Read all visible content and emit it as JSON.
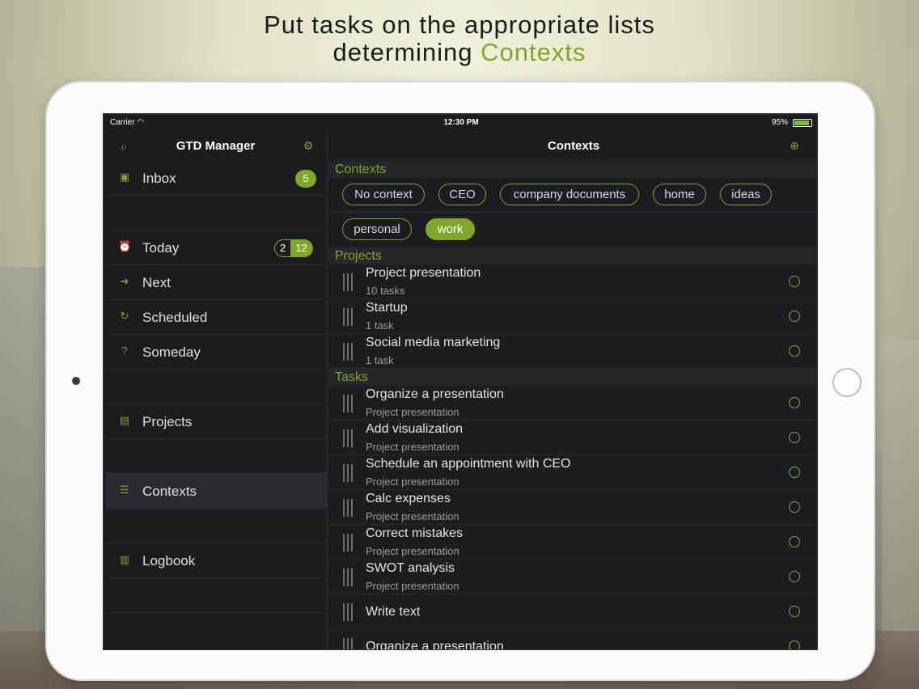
{
  "headline": {
    "line1": "Put tasks on the appropriate lists",
    "line2_prefix": "determining ",
    "line2_accent": "Contexts"
  },
  "statusbar": {
    "carrier": "Carrier",
    "time": "12:30 PM",
    "battery": "95%"
  },
  "sidebar": {
    "title": "GTD Manager",
    "items": [
      {
        "label": "Inbox",
        "icon": "inbox-icon",
        "badge": "5"
      },
      {
        "label": "Today",
        "icon": "alarm-icon",
        "badge_left": "2",
        "badge_right": "12"
      },
      {
        "label": "Next",
        "icon": "arrow-circle-icon"
      },
      {
        "label": "Scheduled",
        "icon": "repeat-icon"
      },
      {
        "label": "Someday",
        "icon": "question-box-icon"
      },
      {
        "label": "Projects",
        "icon": "projects-icon"
      },
      {
        "label": "Contexts",
        "icon": "contexts-icon"
      },
      {
        "label": "Logbook",
        "icon": "logbook-icon"
      }
    ]
  },
  "main": {
    "title": "Contexts",
    "contexts_header": "Contexts",
    "contexts": [
      "No context",
      "CEO",
      "company documents",
      "home",
      "ideas",
      "personal",
      "work"
    ],
    "selected_context": "work",
    "projects_header": "Projects",
    "projects": [
      {
        "title": "Project presentation",
        "subtitle": "10 tasks"
      },
      {
        "title": "Startup",
        "subtitle": "1 task"
      },
      {
        "title": "Social media marketing",
        "subtitle": "1 task"
      }
    ],
    "tasks_header": "Tasks",
    "tasks": [
      {
        "title": "Organize a presentation",
        "subtitle": "Project presentation"
      },
      {
        "title": "Add visualization",
        "subtitle": "Project presentation"
      },
      {
        "title": "Schedule an appointment with CEO",
        "subtitle": "Project presentation"
      },
      {
        "title": "Calc expenses",
        "subtitle": "Project presentation"
      },
      {
        "title": "Correct mistakes",
        "subtitle": "Project presentation"
      },
      {
        "title": "SWOT analysis",
        "subtitle": "Project presentation"
      },
      {
        "title": "Write text",
        "subtitle": ""
      },
      {
        "title": "Organize a presentation",
        "subtitle": ""
      }
    ]
  },
  "colors": {
    "accent": "#7fa72a",
    "screen_bg": "#1c1d21"
  }
}
